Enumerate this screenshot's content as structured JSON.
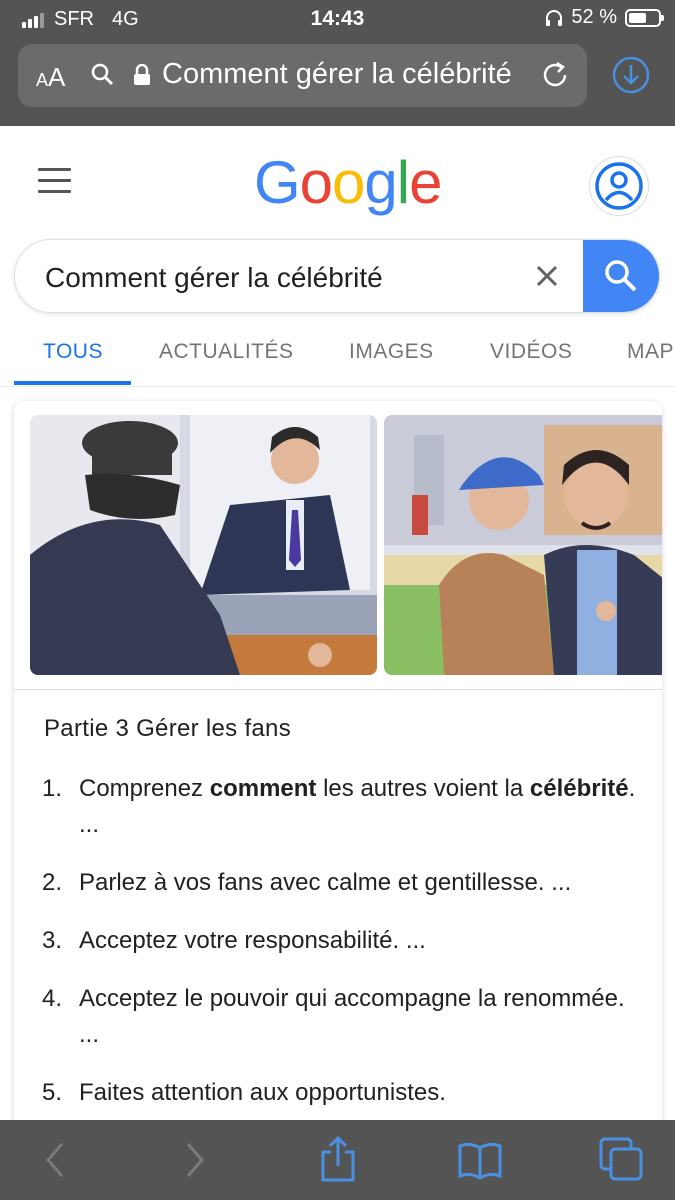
{
  "status_bar": {
    "carrier": "SFR",
    "network": "4G",
    "time": "14:43",
    "battery": "52 %",
    "battery_level": 0.52
  },
  "browser": {
    "text_size_label": "AA",
    "url_text": "Comment gérer la célébrité",
    "icons": [
      "search-icon",
      "lock-icon",
      "reload-icon",
      "download-icon"
    ]
  },
  "google": {
    "logo_letters": [
      "G",
      "o",
      "o",
      "g",
      "l",
      "e"
    ],
    "logo_colors": [
      "#4285F4",
      "#EA4335",
      "#FBBC05",
      "#4285F4",
      "#34A853",
      "#EA4335"
    ],
    "query": "Comment gérer la célébrité",
    "tabs": [
      "TOUS",
      "ACTUALITÉS",
      "IMAGES",
      "VIDÉOS",
      "MAPS"
    ],
    "active_tab": "TOUS",
    "accent_color": "#1a73e8"
  },
  "snippet": {
    "heading": "Partie 3 Gérer les fans",
    "steps": [
      {
        "num": "1.",
        "parts": [
          "Comprenez ",
          "comment",
          " les autres voient la ",
          "célébrité",
          ". ..."
        ]
      },
      {
        "num": "2.",
        "text": "Parlez à vos fans avec calme et gentillesse. ..."
      },
      {
        "num": "3.",
        "text": "Acceptez votre responsabilité. ..."
      },
      {
        "num": "4.",
        "text": "Acceptez le pouvoir qui accompagne la renommée. ..."
      },
      {
        "num": "5.",
        "text": "Faites attention aux opportunistes."
      }
    ]
  },
  "toolbar": {
    "icons": [
      "back-icon",
      "forward-icon",
      "share-icon",
      "bookmarks-icon",
      "tabs-icon"
    ]
  }
}
